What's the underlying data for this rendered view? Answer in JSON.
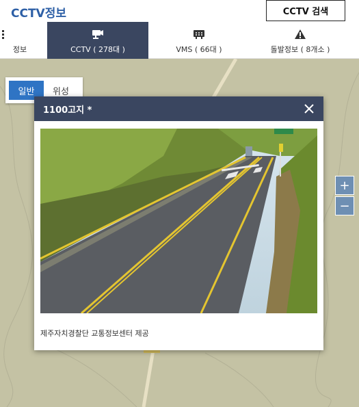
{
  "header": {
    "title": "CCTV정보",
    "search_button": "CCTV 검색"
  },
  "tabs": [
    {
      "label": "정보",
      "icon": "menu-icon",
      "active": false
    },
    {
      "label": "CCTV ( 278대 )",
      "icon": "cctv-camera-icon",
      "active": true
    },
    {
      "label": "VMS ( 66대 )",
      "icon": "vms-sign-icon",
      "active": false
    },
    {
      "label": "돌발정보 ( 8개소 )",
      "icon": "warning-icon",
      "active": false
    }
  ],
  "map_type": {
    "general": "일반",
    "satellite": "위성",
    "selected": "일반"
  },
  "zoom": {
    "plus": "+",
    "minus": "−"
  },
  "popup": {
    "title": "1100고지 *",
    "credit": "제주자치경찰단 교통정보센터 제공"
  },
  "colors": {
    "brand": "#2d5fa6",
    "tab_active_bg": "#3a4660",
    "map_bg": "#c4c2a4",
    "map_type_active": "#2f74c4",
    "zoom_bg": "#6e8fb3"
  }
}
